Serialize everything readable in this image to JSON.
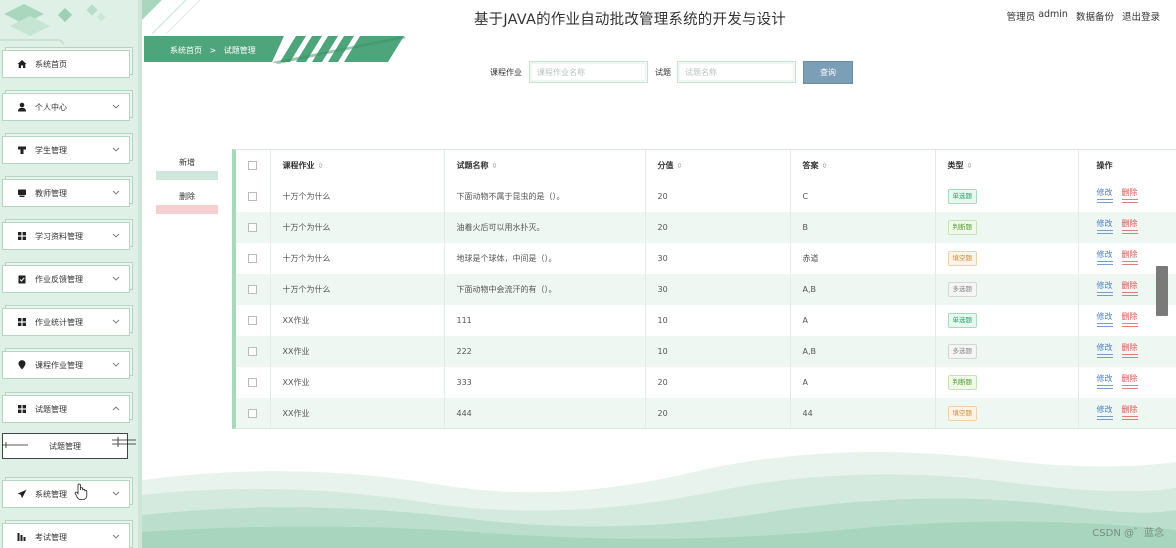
{
  "header": {
    "title": "基于JAVA的作业自动批改管理系统的开发与设计",
    "user_role": "管理员",
    "username": "admin",
    "backup_link": "数据备份",
    "logout_link": "退出登录"
  },
  "breadcrumb": {
    "home": "系统首页",
    "separator": ">",
    "current": "试题管理"
  },
  "search": {
    "course_label": "课程作业",
    "course_placeholder": "课程作业名称",
    "question_label": "试题",
    "question_placeholder": "试题名称",
    "query_button": "查询"
  },
  "actions": {
    "add": "新增",
    "delete": "删除"
  },
  "sidebar": {
    "items": [
      {
        "label": "系统首页",
        "icon": "home-icon"
      },
      {
        "label": "个人中心",
        "icon": "user-icon"
      },
      {
        "label": "学生管理",
        "icon": "student-icon"
      },
      {
        "label": "教师管理",
        "icon": "teacher-icon"
      },
      {
        "label": "学习资料管理",
        "icon": "grid-icon"
      },
      {
        "label": "作业反馈管理",
        "icon": "clipboard-icon"
      },
      {
        "label": "作业统计管理",
        "icon": "grid-icon"
      },
      {
        "label": "课程作业管理",
        "icon": "pin-icon"
      },
      {
        "label": "试题管理",
        "icon": "grid-icon"
      },
      {
        "label": "系统管理",
        "icon": "send-icon"
      },
      {
        "label": "考试管理",
        "icon": "bars-icon"
      }
    ],
    "submenu_active": "试题管理"
  },
  "table": {
    "headers": {
      "course": "课程作业",
      "name": "试题名称",
      "score": "分值",
      "answer": "答案",
      "type": "类型",
      "op": "操作"
    },
    "edit_label": "修改",
    "delete_label": "删除",
    "rows": [
      {
        "course": "十万个为什么",
        "name": "下面动物不属于昆虫的是（）。",
        "score": "20",
        "answer": "C",
        "type": "单选题",
        "type_class": "single"
      },
      {
        "course": "十万个为什么",
        "name": "油着火后可以用水扑灭。",
        "score": "20",
        "answer": "B",
        "type": "判断题",
        "type_class": "judge"
      },
      {
        "course": "十万个为什么",
        "name": "地球是个球体，中间是（）。",
        "score": "30",
        "answer": "赤道",
        "type": "填空题",
        "type_class": "fill"
      },
      {
        "course": "十万个为什么",
        "name": "下面动物中会流汗的有（）。",
        "score": "30",
        "answer": "A,B",
        "type": "多选题",
        "type_class": "multi"
      },
      {
        "course": "XX作业",
        "name": "111",
        "score": "10",
        "answer": "A",
        "type": "单选题",
        "type_class": "single"
      },
      {
        "course": "XX作业",
        "name": "222",
        "score": "10",
        "answer": "A,B",
        "type": "多选题",
        "type_class": "multi"
      },
      {
        "course": "XX作业",
        "name": "333",
        "score": "20",
        "answer": "A",
        "type": "判断题",
        "type_class": "judge"
      },
      {
        "course": "XX作业",
        "name": "444",
        "score": "20",
        "answer": "44",
        "type": "填空题",
        "type_class": "fill"
      }
    ]
  },
  "watermark": "CSDN @゛蓝念"
}
